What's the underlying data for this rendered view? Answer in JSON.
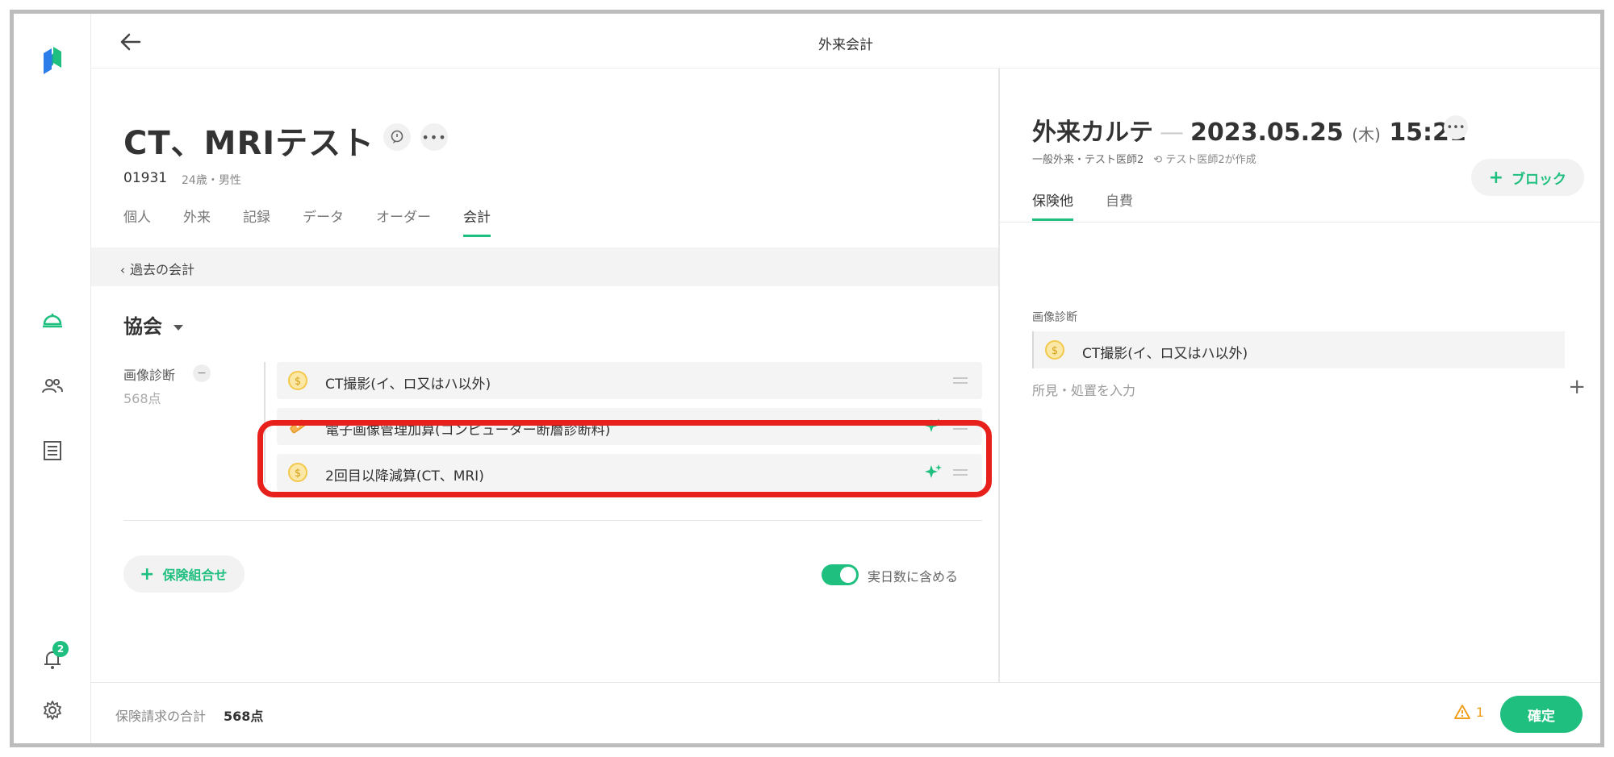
{
  "header": {
    "title": "外来会計"
  },
  "nav": {
    "badge_count": "2",
    "icons": [
      "app-logo-icon",
      "reception-bell-icon",
      "patients-icon",
      "document-list-icon",
      "notification-bell-icon",
      "gear-icon"
    ]
  },
  "patient": {
    "name": "CT、MRIテスト",
    "id": "01931",
    "meta": "24歳・男性"
  },
  "tabs": [
    "個人",
    "外来",
    "記録",
    "データ",
    "オーダー",
    "会計"
  ],
  "active_tab": "会計",
  "past_accounts_link": "過去の会計",
  "insurer": "協会",
  "category": {
    "label": "画像診断",
    "minus": "−",
    "points": "568点"
  },
  "items": [
    {
      "label": "CT撮影(イ、ロ又はハ以外)",
      "icon": "coin-icon"
    },
    {
      "label": "電子画像管理加算(コンピューター断層診断料)",
      "icon": "tape-icon"
    },
    {
      "label": "2回目以降減算(CT、MRI)",
      "icon": "coin-icon"
    }
  ],
  "add_combo_button": "保険組合せ",
  "toggle_label": "実日数に含める",
  "karte": {
    "title": "外来カルテ",
    "dash": "—",
    "date": "2023.05.25",
    "dow": "(木)",
    "time": "15:21",
    "subtitle": "一般外来・テスト医師2",
    "history": "テスト医師2が作成",
    "add_block_button": "ブロック",
    "tabs": [
      "保険他",
      "自費"
    ],
    "category": "画像診断",
    "item": "CT撮影(イ、ロ又はハ以外)",
    "input_placeholder": "所見・処置を入力"
  },
  "footer": {
    "total_label": "保険請求の合計",
    "total_value": "568点",
    "warning_count": "1",
    "confirm_button": "確定"
  },
  "colors": {
    "accent": "#1fbf7f",
    "highlight": "#e8201c",
    "coin": "#f2c94c",
    "warning": "#f0a020"
  }
}
